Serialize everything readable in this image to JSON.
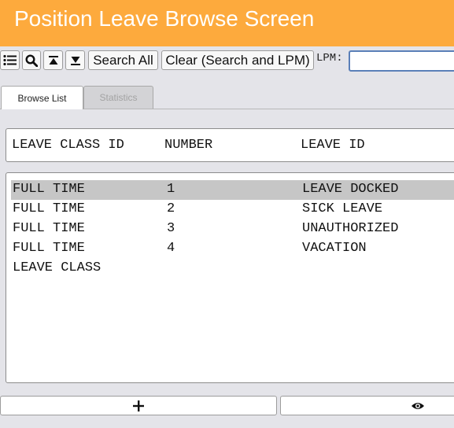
{
  "window": {
    "title": "Position Leave Browse Screen"
  },
  "toolbar": {
    "icons": [
      "list-icon",
      "search-icon",
      "first-record-icon",
      "last-record-icon"
    ],
    "search_all_label": "Search All",
    "clear_label": "Clear (Search and LPM)",
    "lpm_label": "LPM:",
    "lpm_value": ""
  },
  "tabs": [
    {
      "label": "Browse List",
      "active": true
    },
    {
      "label": "Statistics",
      "active": false
    }
  ],
  "columns": [
    "LEAVE CLASS ID",
    "NUMBER",
    "LEAVE ID"
  ],
  "rows": [
    {
      "leave_class_id": "FULL TIME",
      "number": "1",
      "leave_id": "LEAVE DOCKED",
      "selected": true
    },
    {
      "leave_class_id": "FULL TIME",
      "number": "2",
      "leave_id": "SICK LEAVE",
      "selected": false
    },
    {
      "leave_class_id": "FULL TIME",
      "number": "3",
      "leave_id": "UNAUTHORIZED",
      "selected": false
    },
    {
      "leave_class_id": "FULL TIME",
      "number": "4",
      "leave_id": "VACATION",
      "selected": false
    },
    {
      "leave_class_id": "LEAVE CLASS",
      "number": "",
      "leave_id": "",
      "selected": false
    }
  ],
  "footer": {
    "icons": [
      "plus-icon",
      "eye-icon"
    ]
  },
  "colors": {
    "title_bar": "#fdaa3d",
    "background": "#e4e4e9",
    "selected_row": "#c6c6c6",
    "input_focus_border": "#5a7fb8"
  }
}
